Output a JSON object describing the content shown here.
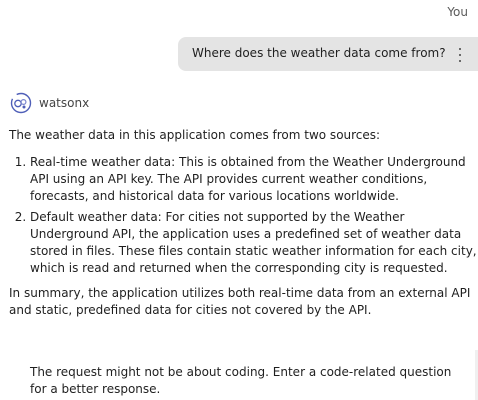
{
  "header": {
    "you_label": "You"
  },
  "user_message": {
    "text": "Where does the weather data come from?",
    "menu_icon": "overflow-menu-vertical-icon"
  },
  "bot": {
    "name": "watsonx",
    "avatar_icon": "watsonx-logo-icon",
    "intro": "The weather data in this application comes from two sources:",
    "items": [
      "Real-time weather data: This is obtained from the Weather Underground API using an API key. The API provides current weather conditions, forecasts, and historical data for various locations worldwide.",
      "Default weather data: For cities not supported by the Weather Underground API, the application uses a predefined set of weather data stored in files. These files contain static weather information for each city, which is read and returned when the corresponding city is requested."
    ],
    "summary": "In summary, the application utilizes both real-time data from an external API and static, predefined data for cities not covered by the API."
  },
  "notice": {
    "text": "The request might not be about coding. Enter a code-related question for a better response."
  },
  "colors": {
    "bubble": "#e4e4e4",
    "accent": "#4f5fb8"
  }
}
